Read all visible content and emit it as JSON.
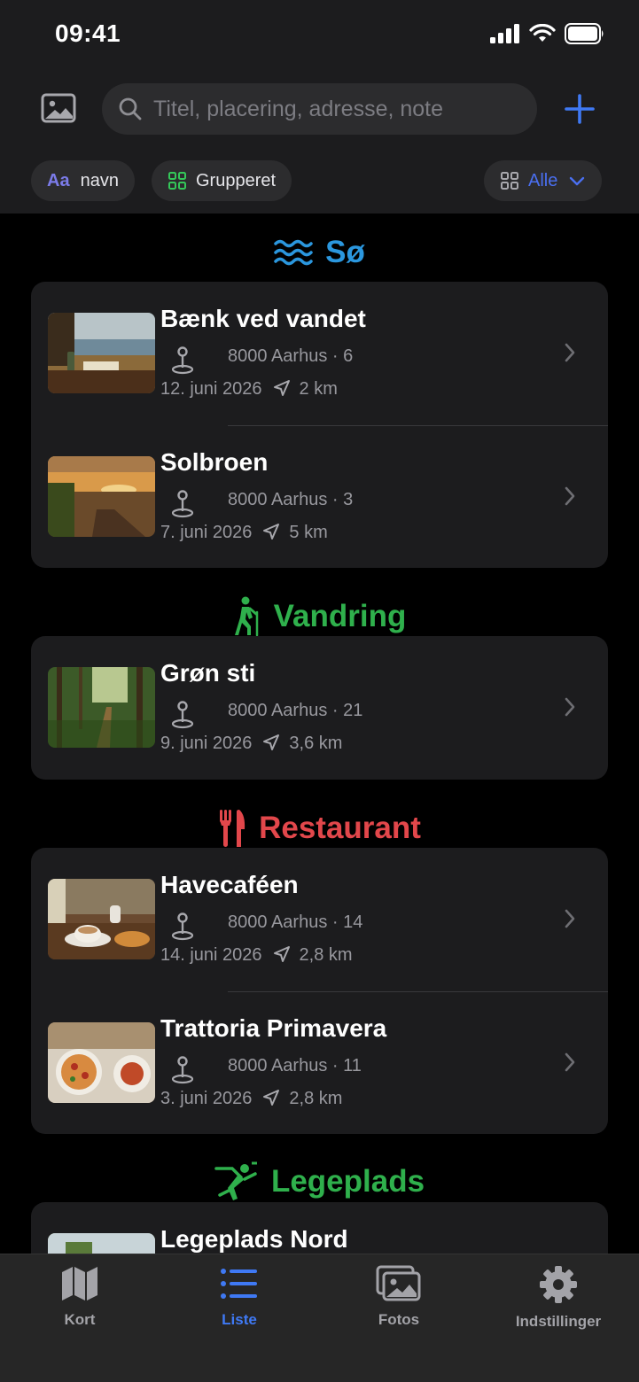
{
  "status_bar": {
    "time": "09:41"
  },
  "header": {
    "search": {
      "placeholder": "Titel, placering, adresse, note"
    },
    "filters": {
      "sort_prefix": "Aa",
      "sort_label": "navn",
      "group_label": "Grupperet",
      "scope_label": "Alle"
    }
  },
  "colors": {
    "accent": "#3f79f4",
    "lake": "#2b97de",
    "hiking": "#2fb04c",
    "restaurant": "#e2474b",
    "playground": "#2fb04c"
  },
  "sections": [
    {
      "title": "Sø",
      "icon": "water-waves-icon",
      "items": [
        {
          "title": "Bænk ved vandet",
          "address": "8000 Aarhus · 6",
          "date": "12. juni 2026",
          "distance": "2 km"
        },
        {
          "title": "Solbroen",
          "address": "8000 Aarhus · 3",
          "date": "7. juni 2026",
          "distance": "5 km"
        }
      ]
    },
    {
      "title": "Vandring",
      "icon": "hiker-icon",
      "items": [
        {
          "title": "Grøn sti",
          "address": "8000 Aarhus · 21",
          "date": "9. juni 2026",
          "distance": "3,6 km"
        }
      ]
    },
    {
      "title": "Restaurant",
      "icon": "fork-knife-icon",
      "items": [
        {
          "title": "Havecaféen",
          "address": "8000 Aarhus · 14",
          "date": "14. juni 2026",
          "distance": "2,8 km"
        },
        {
          "title": "Trattoria Primavera",
          "address": "8000 Aarhus · 11",
          "date": "3. juni 2026",
          "distance": "2,8 km"
        }
      ]
    },
    {
      "title": "Legeplads",
      "icon": "playground-figure-icon",
      "items": [
        {
          "title": "Legeplads Nord"
        }
      ]
    }
  ],
  "tabbar": {
    "tabs": [
      {
        "label": "Kort",
        "icon": "map-icon"
      },
      {
        "label": "Liste",
        "icon": "list-icon",
        "active": true
      },
      {
        "label": "Fotos",
        "icon": "photos-icon"
      },
      {
        "label": "Indstillinger",
        "icon": "gear-icon"
      }
    ]
  }
}
